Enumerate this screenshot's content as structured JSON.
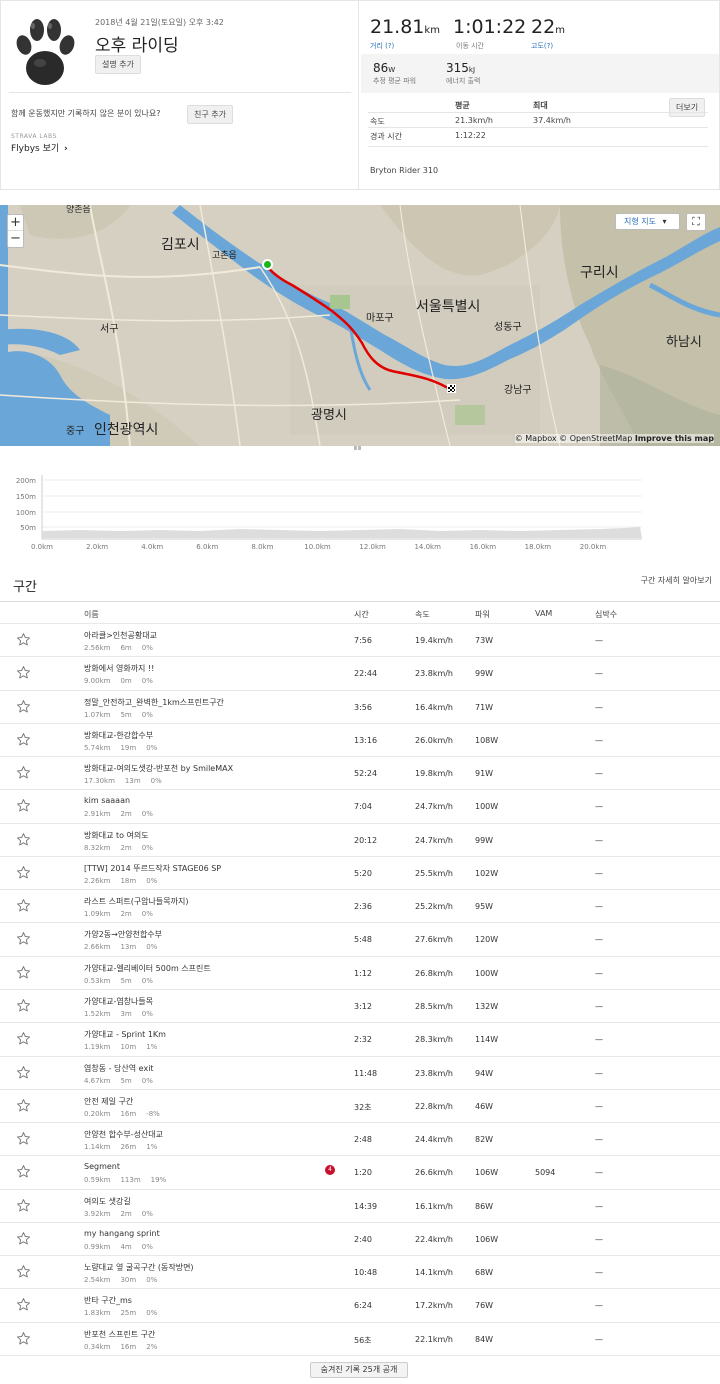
{
  "activity": {
    "date": "2018년 4월 21일(토요일) 오후 3:42",
    "title": "오후 라이딩",
    "add_description": "설명 추가",
    "untagged_prompt": "함께 운동했지만 기록하지 않은 분이 있나요?",
    "add_friend": "친구 추가",
    "labs_label": "STRAVA LABS",
    "flybys": "Flybys 보기",
    "flybys_chevron": "›"
  },
  "stats": {
    "distance": {
      "value": "21.81",
      "unit": "km",
      "label": "거리 (?)"
    },
    "moving_time": {
      "value": "1:01:22",
      "label": "이동 시간"
    },
    "elevation": {
      "value": "22",
      "unit": "m",
      "label": "고도(?)"
    },
    "power": {
      "value": "86",
      "unit": "W",
      "label": "추정 평균 파워"
    },
    "energy": {
      "value": "315",
      "unit": "kJ",
      "label": "에너지 출력"
    },
    "table": {
      "col_avg": "평균",
      "col_max": "최대",
      "more": "더보기",
      "speed_label": "속도",
      "speed_avg": "21.3km/h",
      "speed_max": "37.4km/h",
      "elapsed_label": "경과 시간",
      "elapsed_avg": "1:12:22"
    },
    "device": "Bryton Rider 310"
  },
  "map": {
    "zoom_in": "+",
    "zoom_out": "−",
    "terrain_button": "지형 지도",
    "terrain_caret": "▾",
    "fullscreen": "⛶",
    "attribution": "© Mapbox © OpenStreetMap",
    "improve": "Improve this map",
    "places": {
      "yangchon": "양촌읍",
      "gimpo": "김포시",
      "gochon": "고촌읍",
      "seoul": "서울특별시",
      "mapo": "마포구",
      "seongdong": "성동구",
      "guri": "구리시",
      "hanam": "하남시",
      "seo": "서구",
      "gangnam": "강남구",
      "gwangmyeong": "광명시",
      "junggu": "중구",
      "incheon": "인천광역시"
    },
    "route_color": "#e00000"
  },
  "elevation": {
    "y_ticks": [
      "200m",
      "150m",
      "100m",
      "50m"
    ],
    "x_ticks": [
      "0.0km",
      "2.0km",
      "4.0km",
      "6.0km",
      "8.0km",
      "10.0km",
      "12.0km",
      "14.0km",
      "16.0km",
      "18.0km",
      "20.0km"
    ]
  },
  "segments": {
    "title": "구간",
    "explain_link": "구간 자세히 알아보기",
    "headers": {
      "name": "이름",
      "time": "시간",
      "speed": "속도",
      "power": "파워",
      "vam": "VAM",
      "hr": "심박수"
    },
    "rows": [
      {
        "name": "아라클>인천공황대교",
        "dist": "2.56km",
        "elev": "6m",
        "grade": "0%",
        "time": "7:56",
        "speed": "19.4km/h",
        "power": "73W",
        "vam": "",
        "hr": "—",
        "badge": ""
      },
      {
        "name": "방화에서 영화까지 !!",
        "dist": "9.00km",
        "elev": "0m",
        "grade": "0%",
        "time": "22:44",
        "speed": "23.8km/h",
        "power": "99W",
        "vam": "",
        "hr": "—",
        "badge": ""
      },
      {
        "name": "정말_안전하고_완벽한_1km스프린트구간",
        "dist": "1.07km",
        "elev": "5m",
        "grade": "0%",
        "time": "3:56",
        "speed": "16.4km/h",
        "power": "71W",
        "vam": "",
        "hr": "—",
        "badge": ""
      },
      {
        "name": "방화대교-한강합수부",
        "dist": "5.74km",
        "elev": "19m",
        "grade": "0%",
        "time": "13:16",
        "speed": "26.0km/h",
        "power": "108W",
        "vam": "",
        "hr": "—",
        "badge": ""
      },
      {
        "name": "방화대교-여의도샛강-반포천 by SmileMAX",
        "dist": "17.30km",
        "elev": "13m",
        "grade": "0%",
        "time": "52:24",
        "speed": "19.8km/h",
        "power": "91W",
        "vam": "",
        "hr": "—",
        "badge": ""
      },
      {
        "name": "kim saaaan",
        "dist": "2.91km",
        "elev": "2m",
        "grade": "0%",
        "time": "7:04",
        "speed": "24.7km/h",
        "power": "100W",
        "vam": "",
        "hr": "—",
        "badge": ""
      },
      {
        "name": "방화대교 to 여의도",
        "dist": "8.32km",
        "elev": "2m",
        "grade": "0%",
        "time": "20:12",
        "speed": "24.7km/h",
        "power": "99W",
        "vam": "",
        "hr": "—",
        "badge": ""
      },
      {
        "name": "[TTW] 2014 뚜르드작자 STAGE06 SP",
        "dist": "2.26km",
        "elev": "18m",
        "grade": "0%",
        "time": "5:20",
        "speed": "25.5km/h",
        "power": "102W",
        "vam": "",
        "hr": "—",
        "badge": ""
      },
      {
        "name": "라스트 스퍼트(구암나들목까지)",
        "dist": "1.09km",
        "elev": "2m",
        "grade": "0%",
        "time": "2:36",
        "speed": "25.2km/h",
        "power": "95W",
        "vam": "",
        "hr": "—",
        "badge": ""
      },
      {
        "name": "가양2동→안양천합수부",
        "dist": "2.66km",
        "elev": "13m",
        "grade": "0%",
        "time": "5:48",
        "speed": "27.6km/h",
        "power": "120W",
        "vam": "",
        "hr": "—",
        "badge": ""
      },
      {
        "name": "가양대교-엘리베이터 500m 스프린트",
        "dist": "0.53km",
        "elev": "5m",
        "grade": "0%",
        "time": "1:12",
        "speed": "26.8km/h",
        "power": "100W",
        "vam": "",
        "hr": "—",
        "badge": ""
      },
      {
        "name": "가양대교-염창나들목",
        "dist": "1.52km",
        "elev": "3m",
        "grade": "0%",
        "time": "3:12",
        "speed": "28.5km/h",
        "power": "132W",
        "vam": "",
        "hr": "—",
        "badge": ""
      },
      {
        "name": "가양대교 - Sprint 1Km",
        "dist": "1.19km",
        "elev": "10m",
        "grade": "1%",
        "time": "2:32",
        "speed": "28.3km/h",
        "power": "114W",
        "vam": "",
        "hr": "—",
        "badge": ""
      },
      {
        "name": "염창동 - 당산역 exit",
        "dist": "4.67km",
        "elev": "5m",
        "grade": "0%",
        "time": "11:48",
        "speed": "23.8km/h",
        "power": "94W",
        "vam": "",
        "hr": "—",
        "badge": ""
      },
      {
        "name": "안전 제일 구간",
        "dist": "0.20km",
        "elev": "16m",
        "grade": "-8%",
        "time": "32초",
        "speed": "22.8km/h",
        "power": "46W",
        "vam": "",
        "hr": "—",
        "badge": ""
      },
      {
        "name": "안양천 합수부-성산대교",
        "dist": "1.14km",
        "elev": "26m",
        "grade": "1%",
        "time": "2:48",
        "speed": "24.4km/h",
        "power": "82W",
        "vam": "",
        "hr": "—",
        "badge": ""
      },
      {
        "name": "Segment",
        "dist": "0.59km",
        "elev": "113m",
        "grade": "19%",
        "time": "1:20",
        "speed": "26.6km/h",
        "power": "106W",
        "vam": "5094",
        "hr": "—",
        "badge": "4"
      },
      {
        "name": "여의도 샛강길",
        "dist": "3.92km",
        "elev": "2m",
        "grade": "0%",
        "time": "14:39",
        "speed": "16.1km/h",
        "power": "86W",
        "vam": "",
        "hr": "—",
        "badge": ""
      },
      {
        "name": "my hangang sprint",
        "dist": "0.99km",
        "elev": "4m",
        "grade": "0%",
        "time": "2:40",
        "speed": "22.4km/h",
        "power": "106W",
        "vam": "",
        "hr": "—",
        "badge": ""
      },
      {
        "name": "노량대교 옆 굴곡구간 (동작방면)",
        "dist": "2.54km",
        "elev": "30m",
        "grade": "0%",
        "time": "10:48",
        "speed": "14.1km/h",
        "power": "68W",
        "vam": "",
        "hr": "—",
        "badge": ""
      },
      {
        "name": "반타 구간_ms",
        "dist": "1.83km",
        "elev": "25m",
        "grade": "0%",
        "time": "6:24",
        "speed": "17.2km/h",
        "power": "76W",
        "vam": "",
        "hr": "—",
        "badge": ""
      },
      {
        "name": "반포천 스프린트 구간",
        "dist": "0.34km",
        "elev": "16m",
        "grade": "2%",
        "time": "56초",
        "speed": "22.1km/h",
        "power": "84W",
        "vam": "",
        "hr": "—",
        "badge": ""
      }
    ],
    "show_hidden": "숨겨진 기록 25개 공개"
  }
}
